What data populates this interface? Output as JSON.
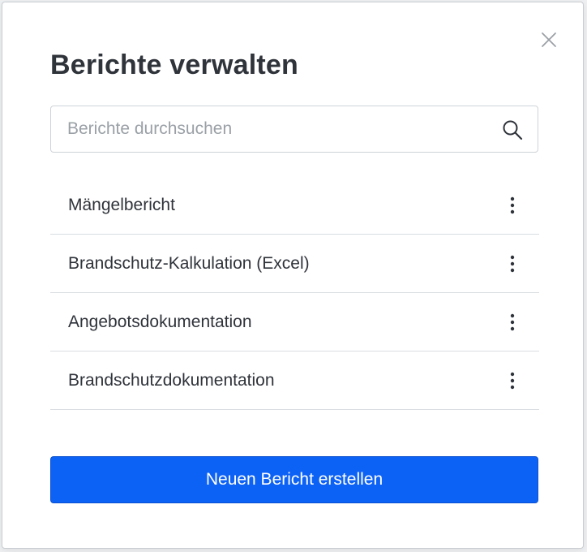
{
  "colors": {
    "primary": "#0d62f6",
    "text": "#2f333a",
    "placeholder": "#9aa0a6",
    "border": "#ced3d8",
    "divider": "#d9dde1"
  },
  "dialog": {
    "title": "Berichte verwalten",
    "close_icon": "close-icon"
  },
  "search": {
    "placeholder": "Berichte durchsuchen",
    "value": "",
    "icon": "search-icon"
  },
  "reports": [
    {
      "label": "Mängelbericht",
      "menu_icon": "more-vertical-icon"
    },
    {
      "label": "Brandschutz-Kalkulation (Excel)",
      "menu_icon": "more-vertical-icon"
    },
    {
      "label": "Angebotsdokumentation",
      "menu_icon": "more-vertical-icon"
    },
    {
      "label": "Brandschutzdokumentation",
      "menu_icon": "more-vertical-icon"
    }
  ],
  "footer": {
    "create_button_label": "Neuen Bericht erstellen"
  }
}
